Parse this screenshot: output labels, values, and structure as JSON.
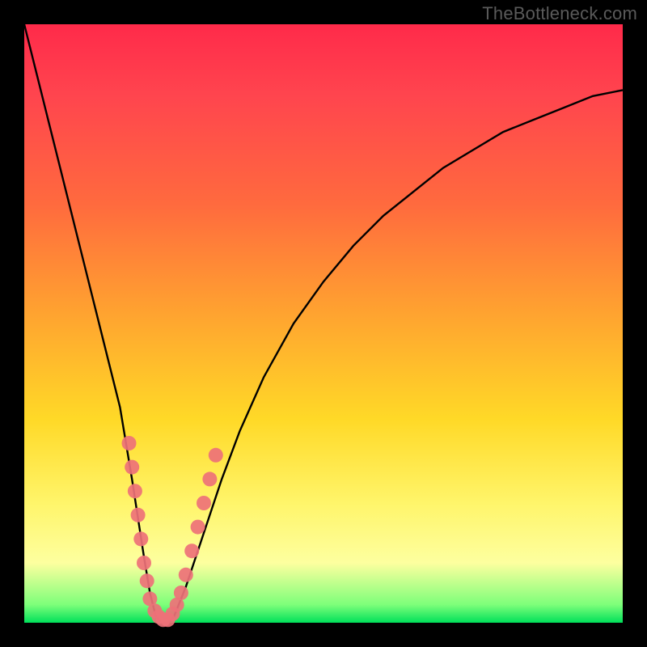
{
  "watermark": "TheBottleneck.com",
  "chart_data": {
    "type": "line",
    "title": "",
    "xlabel": "",
    "ylabel": "",
    "xlim": [
      0,
      100
    ],
    "ylim": [
      0,
      100
    ],
    "series": [
      {
        "name": "bottleneck-curve",
        "x": [
          0,
          2,
          4,
          6,
          8,
          10,
          12,
          14,
          16,
          18,
          20,
          21,
          22,
          23,
          24,
          25,
          27,
          30,
          33,
          36,
          40,
          45,
          50,
          55,
          60,
          65,
          70,
          75,
          80,
          85,
          90,
          95,
          100
        ],
        "y": [
          100,
          92,
          84,
          76,
          68,
          60,
          52,
          44,
          36,
          24,
          11,
          5,
          1,
          0,
          0,
          1,
          6,
          15,
          24,
          32,
          41,
          50,
          57,
          63,
          68,
          72,
          76,
          79,
          82,
          84,
          86,
          88,
          89
        ]
      }
    ],
    "scatter_overlay": {
      "name": "sample-points",
      "points": [
        {
          "x": 17.5,
          "y": 30
        },
        {
          "x": 18.0,
          "y": 26
        },
        {
          "x": 18.5,
          "y": 22
        },
        {
          "x": 19.0,
          "y": 18
        },
        {
          "x": 19.5,
          "y": 14
        },
        {
          "x": 20.0,
          "y": 10
        },
        {
          "x": 20.5,
          "y": 7
        },
        {
          "x": 21.0,
          "y": 4
        },
        {
          "x": 21.8,
          "y": 2
        },
        {
          "x": 22.5,
          "y": 1
        },
        {
          "x": 23.2,
          "y": 0.5
        },
        {
          "x": 24.0,
          "y": 0.5
        },
        {
          "x": 24.8,
          "y": 1.5
        },
        {
          "x": 25.5,
          "y": 3
        },
        {
          "x": 26.2,
          "y": 5
        },
        {
          "x": 27.0,
          "y": 8
        },
        {
          "x": 28.0,
          "y": 12
        },
        {
          "x": 29.0,
          "y": 16
        },
        {
          "x": 30.0,
          "y": 20
        },
        {
          "x": 31.0,
          "y": 24
        },
        {
          "x": 32.0,
          "y": 28
        }
      ]
    },
    "gradient_stops": [
      {
        "pos": 0,
        "color": "#ff2a4a"
      },
      {
        "pos": 30,
        "color": "#ff6a3e"
      },
      {
        "pos": 66,
        "color": "#ffd927"
      },
      {
        "pos": 90,
        "color": "#fdff9f"
      },
      {
        "pos": 100,
        "color": "#00e05a"
      }
    ]
  }
}
